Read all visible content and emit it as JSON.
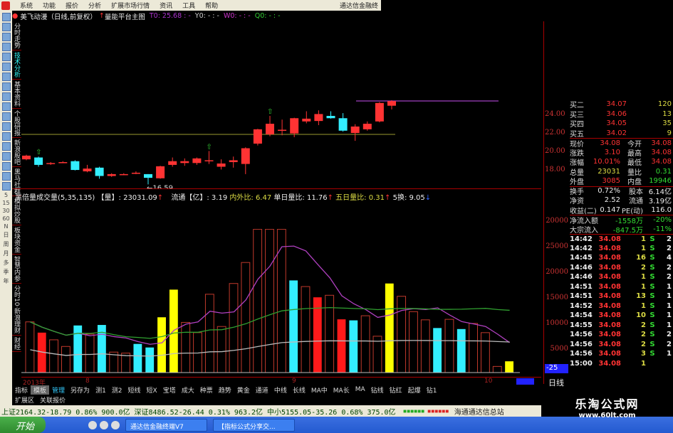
{
  "menu": {
    "items": [
      "系统",
      "功能",
      "报价",
      "分析",
      "扩展市场行情",
      "资讯",
      "工具",
      "帮助"
    ],
    "brand": "通达信金融终"
  },
  "info": {
    "stock": "美飞动漫（日线,前复权）",
    "indicator": "量能平台主图",
    "t0": "T0: 25.68 : -",
    "y0": "Y0: - : -",
    "w0": "W0: - : -",
    "q0": "Q0: - : -"
  },
  "left_toolbar": {
    "period_labels": [
      "5",
      "15",
      "30",
      "60",
      "N",
      "日",
      "周",
      "月",
      "多",
      "季",
      "年"
    ]
  },
  "vtabs": [
    "分时走势",
    "技术分析",
    "基本资料",
    "个股研报",
    "新浪股吧",
    "黑马社群",
    "模拟炒股",
    "板块资金",
    "智慧内参",
    "分时10·新浪理财",
    "财经"
  ],
  "price_axis": [
    "24.00",
    "22.00",
    "20.00",
    "18.00"
  ],
  "chart_data": [
    {
      "type": "candlestick",
      "ylim": [
        16,
        26
      ],
      "low_label": "16.59",
      "ref_line": 22.0,
      "candles": [
        [
          19.3,
          19.7,
          19.8,
          19.2
        ],
        [
          19.5,
          18.7,
          19.6,
          18.5
        ],
        [
          18.9,
          18.9,
          19.0,
          18.7
        ],
        [
          19.0,
          19.0,
          19.1,
          18.9
        ],
        [
          19.1,
          18.15,
          19.2,
          18.1
        ],
        [
          18.0,
          18.3,
          18.7,
          17.9
        ],
        [
          18.4,
          17.5,
          18.5,
          17.2
        ],
        [
          17.5,
          17.7,
          17.8,
          17.4
        ],
        [
          17.7,
          17.7,
          17.8,
          17.6
        ],
        [
          17.85,
          17.85,
          18.0,
          17.7
        ],
        [
          17.7,
          17.3,
          17.7,
          16.59
        ],
        [
          17.25,
          18.55,
          18.6,
          17.2
        ],
        [
          18.7,
          19.1,
          19.5,
          18.5
        ],
        [
          18.9,
          19.1,
          19.4,
          18.6
        ],
        [
          18.9,
          19.4,
          19.5,
          18.7
        ],
        [
          19.2,
          19.2,
          20.2,
          18.8
        ],
        [
          18.5,
          18.85,
          19.3,
          18.2
        ],
        [
          19.0,
          19.2,
          19.6,
          18.4
        ],
        [
          18.8,
          20.5,
          20.6,
          17.7
        ],
        [
          21.0,
          22.55,
          22.6,
          20.8
        ],
        [
          22.0,
          23.15,
          24.0,
          21.8
        ],
        [
          22.5,
          22.5,
          23.6,
          21.9
        ],
        [
          22.1,
          23.75,
          23.8,
          21.7
        ],
        [
          23.4,
          23.7,
          24.5,
          23.2
        ],
        [
          23.45,
          24.2,
          24.6,
          23.0
        ],
        [
          24.0,
          23.75,
          24.5,
          23.7
        ],
        [
          23.75,
          22.4,
          24.3,
          22.3
        ],
        [
          22.15,
          22.85,
          23.1,
          21.3
        ],
        [
          22.55,
          23.15,
          23.4,
          22.4
        ],
        [
          23.4,
          25.4,
          25.5,
          23.3
        ],
        [
          25.1,
          25.6,
          25.7,
          24.7
        ]
      ],
      "up_arrows_at": [
        1,
        15,
        20
      ]
    },
    {
      "type": "bar",
      "title": "黑倍量成交量(5,35,135)",
      "ylim": [
        0,
        30000
      ],
      "tick_labels": [
        "20000",
        "25000",
        "20000",
        "15000",
        "10000",
        "5000"
      ],
      "values": [
        9900,
        7800,
        6400,
        5100,
        9200,
        7500,
        9300,
        4000,
        3800,
        5600,
        4900,
        10800,
        16200,
        9800,
        7800,
        15300,
        9000,
        17400,
        21500,
        28000,
        28000,
        28000,
        18000,
        16800,
        14700,
        15100,
        10400,
        10200,
        11100,
        7100,
        17400,
        14900,
        11900,
        10300,
        8700,
        10400,
        8500,
        9600,
        7800,
        1200,
        2200
      ],
      "colors": [
        "h",
        "r",
        "h",
        "h",
        "c",
        "h",
        "c",
        "h",
        "h",
        "c",
        "c",
        "y",
        "y",
        "h",
        "h",
        "h",
        "h",
        "h",
        "h",
        "h",
        "h",
        "h",
        "c",
        "h",
        "r",
        "h",
        "r",
        "c",
        "h",
        "h",
        "y",
        "h",
        "h",
        "h",
        "c",
        "h",
        "c",
        "h",
        "h",
        "h",
        "y"
      ],
      "palette": {
        "h": "#c0392b",
        "r": "#ff1a1a",
        "c": "#33eeff",
        "y": "#ffff00"
      }
    }
  ],
  "volinfo": {
    "name": "黑倍量成交量(5,35,135)",
    "vol": "【量】: 23031.09",
    "flow": "流通【亿】: 3.19",
    "ratio": "内外比: 6.47",
    "single": "单日量比: 11.76",
    "five": "五日量比: 0.31",
    "turn": "5换: 9.05"
  },
  "dates": [
    "2013年",
    "8",
    "9",
    "10"
  ],
  "tabs": [
    "指标",
    "模板",
    "管理",
    "另存为",
    "测1",
    "测2",
    "短线",
    "短X",
    "宝塔",
    "成大",
    "种票",
    "趋势",
    "黄金",
    "通道",
    "中线",
    "长线",
    "MA中",
    "MA长",
    "MA",
    "钻线",
    "钻红",
    "起爆",
    "钻1"
  ],
  "tabs2": [
    "扩展区",
    "关联报价"
  ],
  "quote": {
    "bids": [
      [
        "买二",
        "34.07",
        "120"
      ],
      [
        "买三",
        "34.06",
        "13"
      ],
      [
        "买四",
        "34.05",
        "35"
      ],
      [
        "买五",
        "34.02",
        "9"
      ]
    ],
    "stats": [
      [
        "现价",
        "34.08",
        "今开",
        "34.08"
      ],
      [
        "涨跌",
        "3.10",
        "最高",
        "34.08"
      ],
      [
        "涨幅",
        "10.01%",
        "最低",
        "34.08"
      ],
      [
        "总量",
        "23031",
        "量比",
        "0.31"
      ],
      [
        "外盘",
        "3085",
        "内盘",
        "19946"
      ]
    ],
    "stats2": [
      [
        "换手",
        "0.72%",
        "股本",
        "6.14亿"
      ],
      [
        "净资",
        "2.52",
        "流通",
        "3.19亿"
      ],
      [
        "收益(二)",
        "0.147",
        "PE(动)",
        "116.0"
      ]
    ],
    "flows": [
      [
        "净流入额",
        "-1558万",
        "-20%"
      ],
      [
        "大宗流入",
        "-847.5万",
        "-11%"
      ]
    ],
    "ticks": [
      [
        "14:42",
        "34.08",
        "1",
        "S",
        "2"
      ],
      [
        "14:42",
        "34.08",
        "1",
        "S",
        "2"
      ],
      [
        "14:45",
        "34.08",
        "16",
        "S",
        "4"
      ],
      [
        "14:46",
        "34.08",
        "2",
        "S",
        "2"
      ],
      [
        "14:46",
        "34.08",
        "1",
        "S",
        "2"
      ],
      [
        "14:51",
        "34.08",
        "1",
        "S",
        "1"
      ],
      [
        "14:51",
        "34.08",
        "13",
        "S",
        "1"
      ],
      [
        "14:52",
        "34.08",
        "1",
        "S",
        "1"
      ],
      [
        "14:54",
        "34.08",
        "10",
        "S",
        "1"
      ],
      [
        "14:55",
        "34.08",
        "2",
        "S",
        "1"
      ],
      [
        "14:56",
        "34.08",
        "2",
        "S",
        "2"
      ],
      [
        "14:56",
        "34.08",
        "2",
        "S",
        "2"
      ],
      [
        "14:56",
        "34.08",
        "3",
        "S",
        "1"
      ],
      [
        "15:00",
        "34.08",
        "1",
        "",
        ""
      ]
    ],
    "period": "日线",
    "scroll_value": "-25"
  },
  "status": {
    "sh": "上证2164.32-18.79 0.86% 900.0亿",
    "sz": "深证8486.52-26.44 0.31% 963.2亿",
    "zx": "中小5155.05-35.26 0.68% 375.0亿",
    "site": "海通通达信总站"
  },
  "taskbar": {
    "start": "开始",
    "tasks": [
      "通达信金融终端V7",
      "【指标公式分享交..."
    ]
  },
  "watermark": {
    "name": "乐淘公式网",
    "url": "www.60lt.com"
  }
}
